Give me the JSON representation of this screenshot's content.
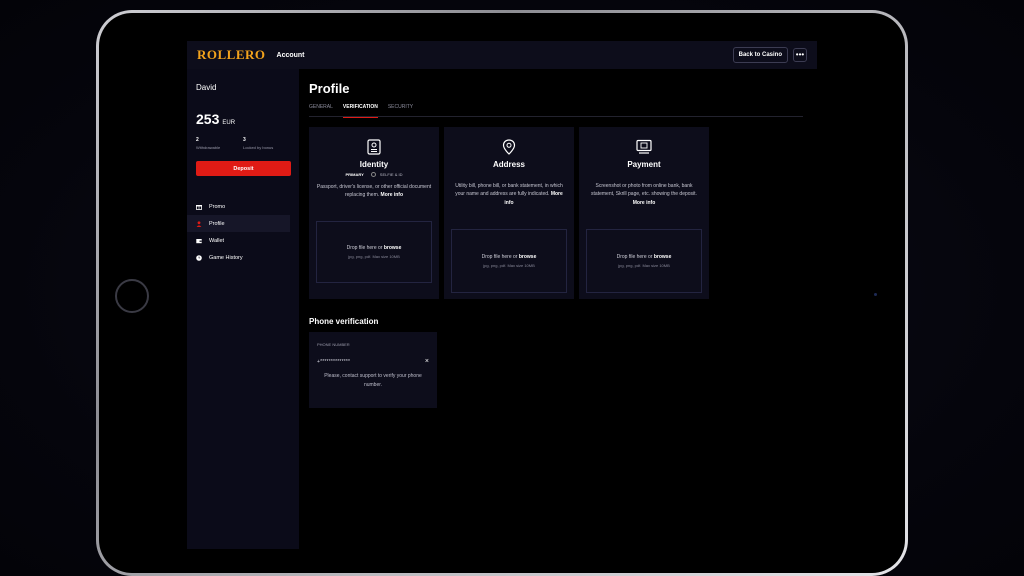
{
  "topbar": {
    "logo": "ROLLERO",
    "account_label": "Account",
    "back_button": "Back to Casino",
    "more_button": "•••"
  },
  "sidebar": {
    "user_name": "David",
    "balance_amount": "253",
    "balance_currency": "EUR",
    "withdrawable_value": "2",
    "withdrawable_label": "Withdrawable",
    "locked_value": "3",
    "locked_label": "Locked by bonus",
    "deposit_button": "Deposit",
    "nav": [
      {
        "label": "Promo",
        "icon": "gift-icon"
      },
      {
        "label": "Profile",
        "icon": "user-icon"
      },
      {
        "label": "Wallet",
        "icon": "wallet-icon"
      },
      {
        "label": "Game History",
        "icon": "clock-icon"
      }
    ]
  },
  "main": {
    "title": "Profile",
    "tabs": [
      "GENERAL",
      "VERIFICATION",
      "SECURITY"
    ],
    "active_tab": "VERIFICATION",
    "cards": [
      {
        "title": "Identity",
        "meta_primary": "PRIMARY",
        "meta_secondary": "SELFIE & ID",
        "description": "Passport, driver's license, or other official document replacing them.",
        "more": "More info",
        "drop_text": "Drop file here or ",
        "browse": "browse",
        "drop_hint": "jpg, png, pdf. Max size 10MB"
      },
      {
        "title": "Address",
        "description": "Utility bill, phone bill, or bank statement, in which your name and address are fully indicated.",
        "more": "More info",
        "drop_text": "Drop file here or ",
        "browse": "browse",
        "drop_hint": "jpg, png, pdf. Max size 10MB"
      },
      {
        "title": "Payment",
        "description": "Screenshot or photo from online bank, bank statement, Skrill page, etc. showing the deposit.",
        "more": "More info",
        "drop_text": "Drop file here or ",
        "browse": "browse",
        "drop_hint": "jpg, png, pdf. Max size 10MB"
      }
    ],
    "phone": {
      "section_title": "Phone verification",
      "label": "PHONE NUMBER",
      "value": "+**************",
      "clear": "×",
      "note": "Please, contact support to verify your phone number."
    }
  },
  "colors": {
    "accent": "#e01b15",
    "logo": "#f3a31c",
    "panel": "#0d0d1b"
  }
}
